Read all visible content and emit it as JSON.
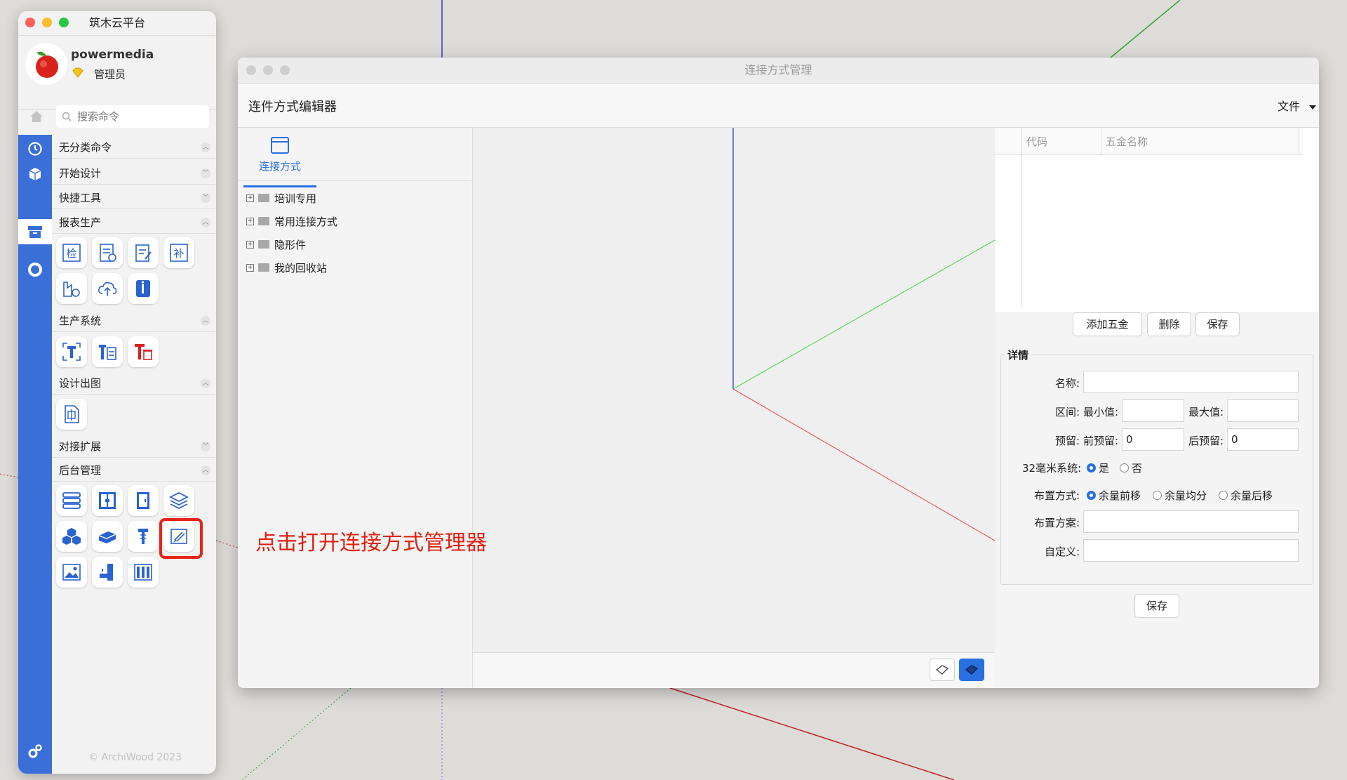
{
  "palette": {
    "title": "筑木云平台",
    "user": {
      "name": "powermedia",
      "role": "管理员"
    },
    "search_placeholder": "搜索命令",
    "sections": {
      "uncategorized": "无分类命令",
      "start_design": "开始设计",
      "quick_tools": "快捷工具",
      "report_production": "报表生产",
      "production_system": "生产系统",
      "design_drawing": "设计出图",
      "integration": "对接扩展",
      "backend_admin": "后台管理"
    },
    "tool_text": {
      "check": "检",
      "supplement": "补"
    },
    "footer": "© ArchiWood 2023"
  },
  "annotation": "点击打开连接方式管理器",
  "window": {
    "title": "连接方式管理",
    "editor_title": "连件方式编辑器",
    "file_menu": "文件",
    "tab_label": "连接方式",
    "tree": [
      "培训专用",
      "常用连接方式",
      "隐形件",
      "我的回收站"
    ],
    "hardware_table": {
      "columns": [
        "代码",
        "五金名称"
      ]
    },
    "buttons": {
      "add_hardware": "添加五金",
      "delete": "删除",
      "save": "保存",
      "save_detail": "保存"
    },
    "details": {
      "legend": "详情",
      "name_label": "名称:",
      "range_label": "区间:",
      "min_label": "最小值:",
      "max_label": "最大值:",
      "reserve_label": "预留:",
      "front_reserve_label": "前预留:",
      "front_reserve_value": "0",
      "back_reserve_label": "后预留:",
      "back_reserve_value": "0",
      "system32_label": "32毫米系统:",
      "system32_options": [
        "是",
        "否"
      ],
      "system32_selected": "是",
      "layout_label": "布置方式:",
      "layout_options": [
        "余量前移",
        "余量均分",
        "余量后移"
      ],
      "layout_selected": "余量前移",
      "scheme_label": "布置方案:",
      "custom_label": "自定义:"
    }
  },
  "colors": {
    "accent": "#3b6fd8",
    "annotation": "#e02010",
    "highlight_border": "#e8231a"
  }
}
